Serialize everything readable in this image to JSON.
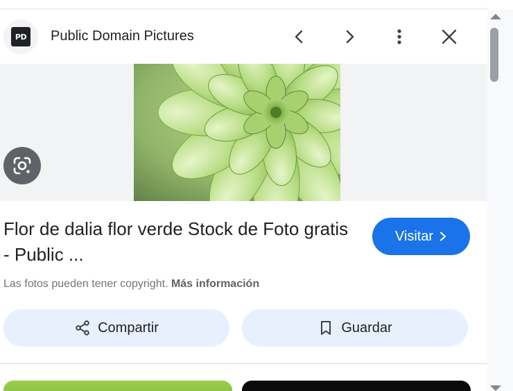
{
  "header": {
    "site_name": "Public Domain Pictures",
    "favicon_text": "PD",
    "icons": {
      "prev": "chevron-left-icon",
      "next": "chevron-right-icon",
      "more": "more-vert-icon",
      "close": "close-icon"
    }
  },
  "image": {
    "subject": "green-dahlia-flower-photo",
    "lens_icon": "google-lens-icon"
  },
  "result": {
    "title": "Flor de dalia flor verde Stock de Foto gratis - Public ...",
    "visit_label": "Visitar",
    "copyright_text": "Las fotos pueden tener copyright.",
    "more_info_label": "Más información"
  },
  "actions": {
    "share_label": "Compartir",
    "save_label": "Guardar",
    "share_icon": "share-icon",
    "save_icon": "bookmark-icon"
  },
  "colors": {
    "accent": "#1a73e8",
    "action_bg": "#e8f0fe",
    "image_bg": "#f1f3f4",
    "text_primary": "#202124",
    "text_secondary": "#70757a"
  }
}
